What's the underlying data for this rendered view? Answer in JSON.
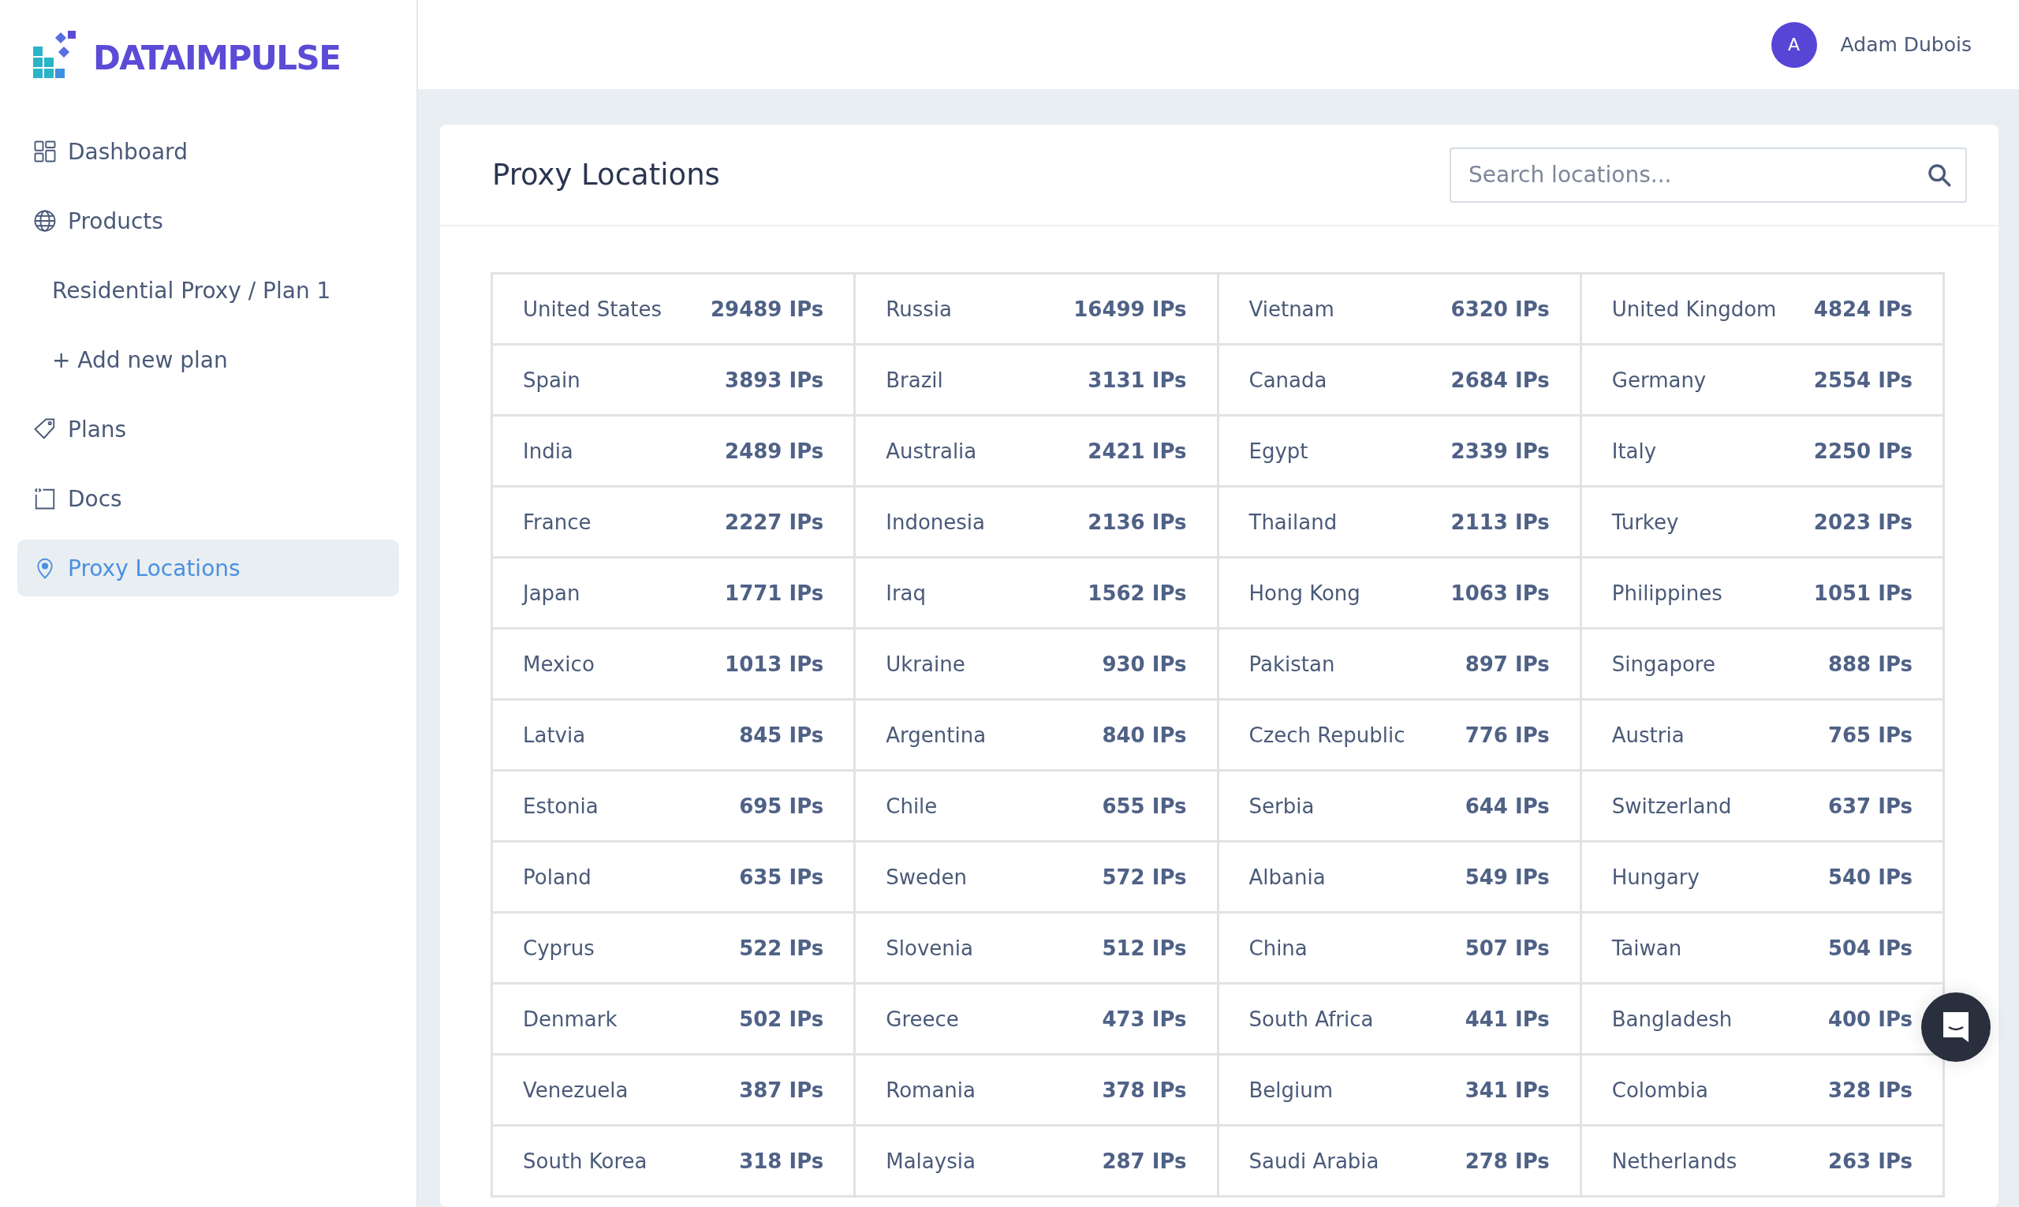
{
  "logo": {
    "text": "DATAIMPULSE"
  },
  "sidebar": {
    "items": [
      {
        "kind": "main",
        "label": "Dashboard",
        "selected": false
      },
      {
        "kind": "main",
        "label": "Products",
        "selected": false
      },
      {
        "kind": "sub",
        "label": "Residential Proxy / Plan 1",
        "selected": false
      },
      {
        "kind": "sub",
        "label": "+ Add new plan",
        "selected": false
      },
      {
        "kind": "main",
        "label": "Plans",
        "selected": false
      },
      {
        "kind": "main",
        "label": "Docs",
        "selected": false
      },
      {
        "kind": "main",
        "label": "Proxy Locations",
        "selected": true
      }
    ]
  },
  "header": {
    "user": {
      "initial": "A",
      "name": "Adam Dubois"
    }
  },
  "page": {
    "title": "Proxy Locations",
    "search": {
      "placeholder": "Search locations..."
    },
    "locations": [
      {
        "country": "United States",
        "count": "29489 IPs"
      },
      {
        "country": "Russia",
        "count": "16499 IPs"
      },
      {
        "country": "Vietnam",
        "count": "6320 IPs"
      },
      {
        "country": "United Kingdom",
        "count": "4824 IPs"
      },
      {
        "country": "Spain",
        "count": "3893 IPs"
      },
      {
        "country": "Brazil",
        "count": "3131 IPs"
      },
      {
        "country": "Canada",
        "count": "2684 IPs"
      },
      {
        "country": "Germany",
        "count": "2554 IPs"
      },
      {
        "country": "India",
        "count": "2489 IPs"
      },
      {
        "country": "Australia",
        "count": "2421 IPs"
      },
      {
        "country": "Egypt",
        "count": "2339 IPs"
      },
      {
        "country": "Italy",
        "count": "2250 IPs"
      },
      {
        "country": "France",
        "count": "2227 IPs"
      },
      {
        "country": "Indonesia",
        "count": "2136 IPs"
      },
      {
        "country": "Thailand",
        "count": "2113 IPs"
      },
      {
        "country": "Turkey",
        "count": "2023 IPs"
      },
      {
        "country": "Japan",
        "count": "1771 IPs"
      },
      {
        "country": "Iraq",
        "count": "1562 IPs"
      },
      {
        "country": "Hong Kong",
        "count": "1063 IPs"
      },
      {
        "country": "Philippines",
        "count": "1051 IPs"
      },
      {
        "country": "Mexico",
        "count": "1013 IPs"
      },
      {
        "country": "Ukraine",
        "count": "930 IPs"
      },
      {
        "country": "Pakistan",
        "count": "897 IPs"
      },
      {
        "country": "Singapore",
        "count": "888 IPs"
      },
      {
        "country": "Latvia",
        "count": "845 IPs"
      },
      {
        "country": "Argentina",
        "count": "840 IPs"
      },
      {
        "country": "Czech Republic",
        "count": "776 IPs"
      },
      {
        "country": "Austria",
        "count": "765 IPs"
      },
      {
        "country": "Estonia",
        "count": "695 IPs"
      },
      {
        "country": "Chile",
        "count": "655 IPs"
      },
      {
        "country": "Serbia",
        "count": "644 IPs"
      },
      {
        "country": "Switzerland",
        "count": "637 IPs"
      },
      {
        "country": "Poland",
        "count": "635 IPs"
      },
      {
        "country": "Sweden",
        "count": "572 IPs"
      },
      {
        "country": "Albania",
        "count": "549 IPs"
      },
      {
        "country": "Hungary",
        "count": "540 IPs"
      },
      {
        "country": "Cyprus",
        "count": "522 IPs"
      },
      {
        "country": "Slovenia",
        "count": "512 IPs"
      },
      {
        "country": "China",
        "count": "507 IPs"
      },
      {
        "country": "Taiwan",
        "count": "504 IPs"
      },
      {
        "country": "Denmark",
        "count": "502 IPs"
      },
      {
        "country": "Greece",
        "count": "473 IPs"
      },
      {
        "country": "South Africa",
        "count": "441 IPs"
      },
      {
        "country": "Bangladesh",
        "count": "400 IPs"
      },
      {
        "country": "Venezuela",
        "count": "387 IPs"
      },
      {
        "country": "Romania",
        "count": "378 IPs"
      },
      {
        "country": "Belgium",
        "count": "341 IPs"
      },
      {
        "country": "Colombia",
        "count": "328 IPs"
      },
      {
        "country": "South Korea",
        "count": "318 IPs"
      },
      {
        "country": "Malaysia",
        "count": "287 IPs"
      },
      {
        "country": "Saudi Arabia",
        "count": "278 IPs"
      },
      {
        "country": "Netherlands",
        "count": "263 IPs"
      }
    ]
  }
}
